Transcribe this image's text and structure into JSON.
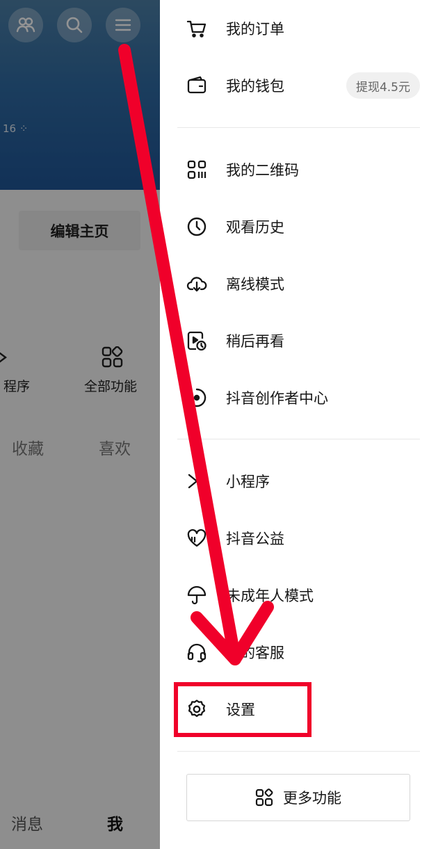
{
  "left_page": {
    "stats_text": "16 ⁘",
    "edit_profile_label": "编辑主页",
    "mini_program_label": "程序",
    "all_functions_label": "全部功能",
    "tabs": [
      {
        "label": "收藏"
      },
      {
        "label": "喜欢"
      }
    ],
    "bottom_nav": [
      {
        "label": "消息"
      },
      {
        "label": "我"
      }
    ]
  },
  "drawer": {
    "groups": [
      [
        {
          "label": "我的订单",
          "icon": "cart-icon"
        },
        {
          "label": "我的钱包",
          "icon": "wallet-icon",
          "badge": "提现4.5元"
        }
      ],
      [
        {
          "label": "我的二维码",
          "icon": "qr-code-icon"
        },
        {
          "label": "观看历史",
          "icon": "clock-icon"
        },
        {
          "label": "离线模式",
          "icon": "cloud-download-icon"
        },
        {
          "label": "稍后再看",
          "icon": "watch-later-icon"
        },
        {
          "label": "抖音创作者中心",
          "icon": "creator-center-icon"
        }
      ],
      [
        {
          "label": "小程序",
          "icon": "mini-program-icon"
        },
        {
          "label": "抖音公益",
          "icon": "charity-heart-icon"
        },
        {
          "label": "未成年人模式",
          "icon": "umbrella-icon"
        },
        {
          "label": "我的客服",
          "icon": "headset-icon"
        },
        {
          "label": "设置",
          "icon": "gear-icon"
        }
      ]
    ],
    "more_functions_label": "更多功能"
  },
  "annotation": {
    "arrow_color": "#f0002a",
    "highlight_target": "设置"
  }
}
